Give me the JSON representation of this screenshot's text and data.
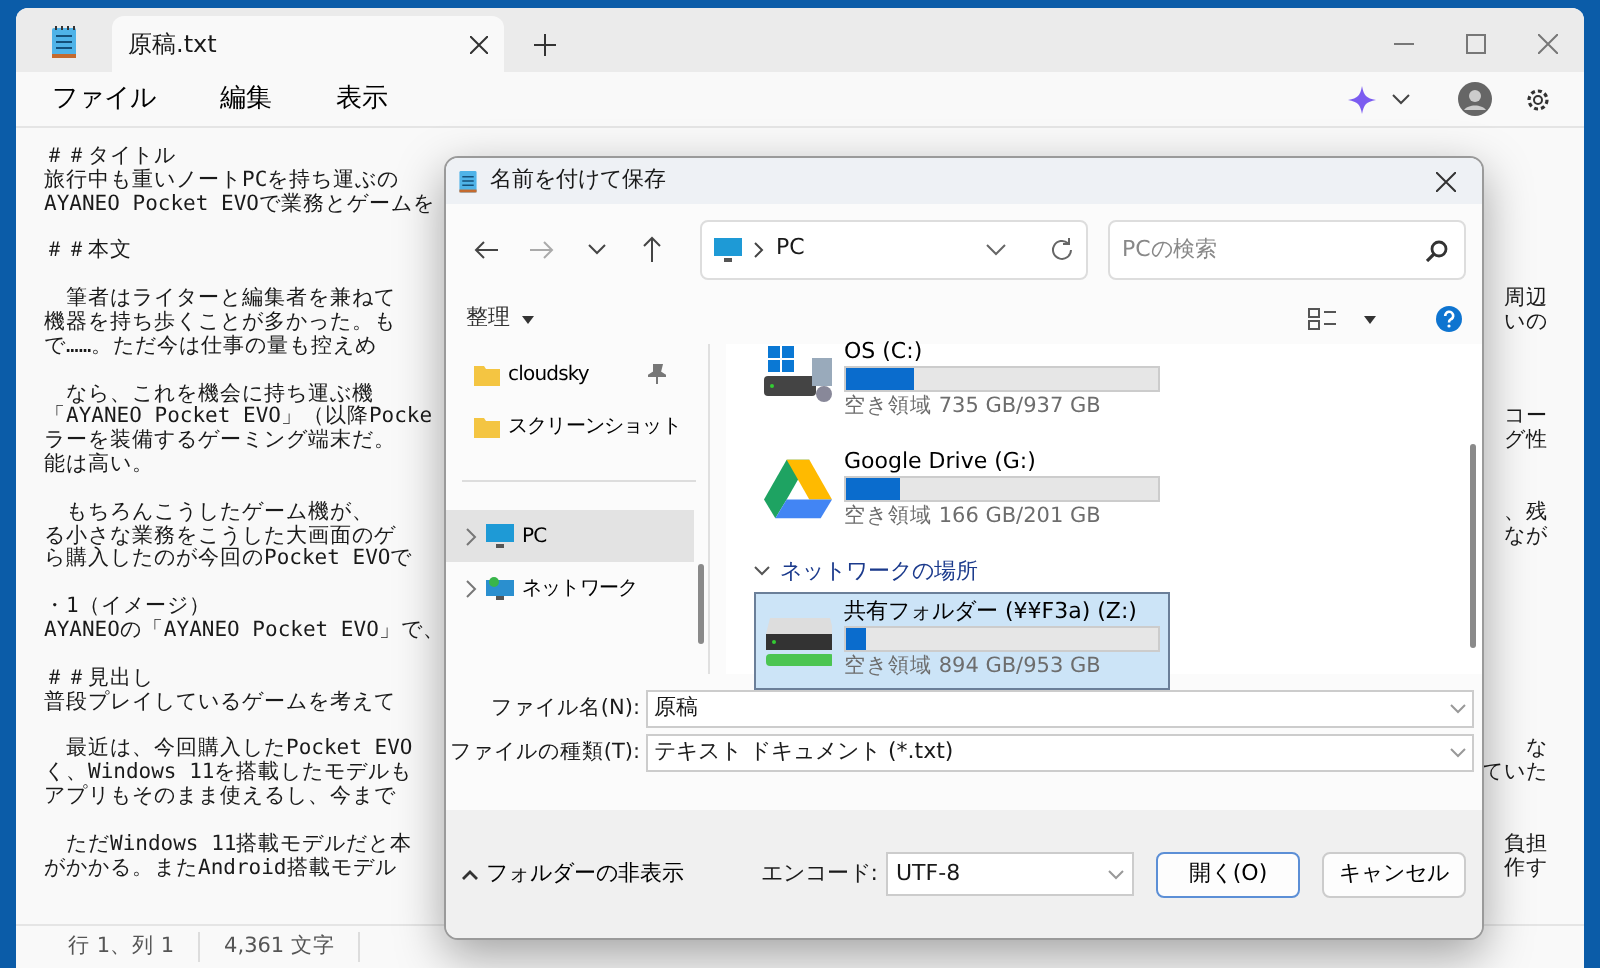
{
  "window": {
    "tabs": [
      {
        "label": "原稿.txt",
        "selected": true
      }
    ],
    "menu": [
      "ファイル",
      "編集",
      "表示"
    ]
  },
  "editor": {
    "paragraphs": [
      {
        "lines": [
          {
            "text": "＃＃タイトル"
          },
          {
            "text": "旅行中も重いノートPCを持ち運ぶの"
          },
          {
            "text": "AYANEO Pocket EVOで業務とゲームを"
          }
        ]
      },
      {
        "lines": [
          {
            "text": "＃＃本文"
          }
        ]
      },
      {
        "lines": [
          {
            "text": "　筆者はライターと編集者を兼ねて",
            "tail": "周辺"
          },
          {
            "text": "機器を持ち歩くことが多かった。も",
            "tail": "いの"
          },
          {
            "text": "で……。ただ今は仕事の量も控えめ"
          }
        ]
      },
      {
        "lines": [
          {
            "text": "　なら、これを機会に持ち運ぶ機"
          },
          {
            "text": "「AYANEO Pocket EVO」（以降Pocke",
            "tail": "コー"
          },
          {
            "text": "ラーを装備するゲーミング端末だ。",
            "tail": "グ性"
          },
          {
            "text": "能は高い。"
          }
        ]
      },
      {
        "lines": [
          {
            "text": "　もちろんこうしたゲーム機が、",
            "tail": "、残"
          },
          {
            "text": "る小さな業務をこうした大画面のゲ",
            "tail": "なが"
          },
          {
            "text": "ら購入したのが今回のPocket EVOで"
          }
        ]
      },
      {
        "lines": [
          {
            "text": "・1（イメージ）"
          },
          {
            "text": "AYANEOの「AYANEO Pocket EVO」で、"
          }
        ]
      },
      {
        "lines": [
          {
            "text": "＃＃見出し"
          },
          {
            "text": "普段プレイしているゲームを考えて"
          }
        ]
      },
      {
        "lines": [
          {
            "text": "　最近は、今回購入したPocket EVO",
            "tail": "な"
          },
          {
            "text": "く、Windows 11を搭載したモデルも",
            "tail": "ていた"
          },
          {
            "text": "アプリもそのまま使えるし、今まで"
          }
        ]
      },
      {
        "lines": [
          {
            "text": "　ただWindows 11搭載モデルだと本",
            "tail": "負担"
          },
          {
            "text": "がかかる。またAndroid搭載モデル",
            "tail": "作す"
          }
        ]
      }
    ]
  },
  "status_bar": [
    "行 1、列 1",
    "4,361 文字"
  ],
  "dialog": {
    "title": "名前を付けて保存",
    "address": "PC",
    "search": {
      "placeholder": "PCの検索"
    },
    "organize": "整理",
    "sidebar": [
      {
        "label": "cloudsky",
        "kind": "folder",
        "pinned": true,
        "selected": false
      },
      {
        "label": "スクリーンショット",
        "kind": "folder",
        "pinned": false,
        "selected": false
      },
      {
        "label": "PC",
        "kind": "pc",
        "pinned": false,
        "selected": true
      },
      {
        "label": "ネットワーク",
        "kind": "network",
        "pinned": false,
        "selected": false
      }
    ],
    "drives": [
      {
        "name": "OS (C:)",
        "kind": "system",
        "level": 0.216,
        "free": "空き領域 735 GB/937 GB",
        "selected": false
      },
      {
        "name": "Google Drive (G:)",
        "kind": "cloud",
        "level": 0.174,
        "free": "空き領域 166 GB/201 GB",
        "selected": false
      }
    ],
    "group": {
      "label": "ネットワークの場所",
      "expanded": true
    },
    "network_drives": [
      {
        "name": "共有フォルダー (¥¥F3a) (Z:)",
        "kind": "network",
        "level": 0.062,
        "free": "空き領域 894 GB/953 GB",
        "selected": true
      }
    ],
    "file_name": {
      "label": "ファイル名(N):",
      "value": "原稿"
    },
    "file_type": {
      "label": "ファイルの種類(T):",
      "value": "テキスト ドキュメント (*.txt)"
    },
    "hide_folders": "フォルダーの非表示",
    "encoding": {
      "label": "エンコード:",
      "value": "UTF-8"
    },
    "buttons": [
      "開く(O)",
      "キャンセル"
    ]
  }
}
